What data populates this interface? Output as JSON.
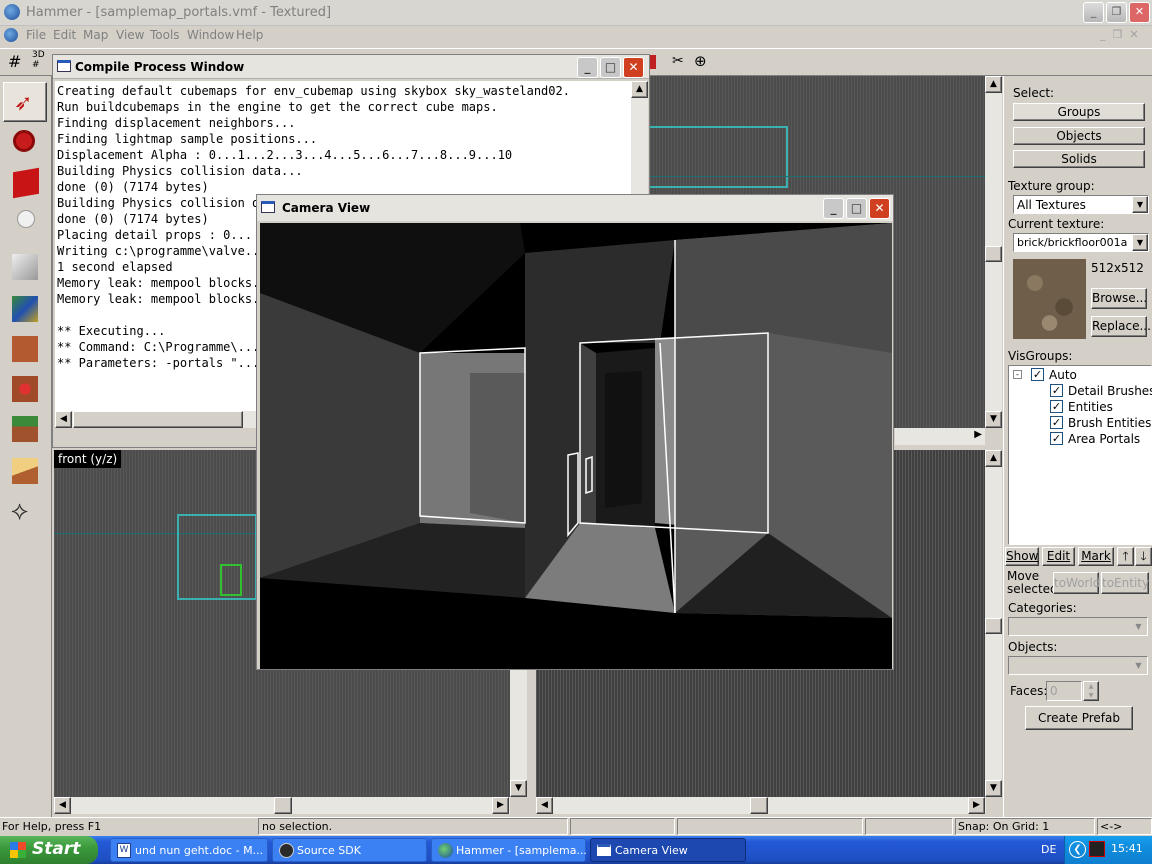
{
  "app": {
    "title": "Hammer - [samplemap_portals.vmf - Textured]"
  },
  "menu": [
    "File",
    "Edit",
    "Map",
    "View",
    "Tools",
    "Window",
    "Help"
  ],
  "compile": {
    "title": "Compile Process Window",
    "lines": [
      "Creating default cubemaps for env_cubemap using skybox sky_wasteland02.",
      "Run buildcubemaps in the engine to get the correct cube maps.",
      "Finding displacement neighbors...",
      "Finding lightmap sample positions...",
      "Displacement Alpha : 0...1...2...3...4...5...6...7...8...9...10",
      "Building Physics collision data...",
      "done (0) (7174 bytes)",
      "Building Physics collision data...",
      "done (0) (7174 bytes)",
      "Placing detail props : 0...",
      "Writing c:\\programme\\valve...",
      "1 second elapsed",
      "Memory leak: mempool blocks...",
      "Memory leak: mempool blocks...",
      "",
      "** Executing...",
      "** Command: C:\\Programme\\...",
      "** Parameters: -portals \"..."
    ]
  },
  "camera": {
    "title": "Camera View"
  },
  "viewport": {
    "front_label": "front (y/z)"
  },
  "panel": {
    "select_label": "Select:",
    "groups": "Groups",
    "objects": "Objects",
    "solids": "Solids",
    "texture_group_label": "Texture group:",
    "texture_group_value": "All Textures",
    "current_texture_label": "Current texture:",
    "current_texture_value": "brick/brickfloor001a",
    "texture_size": "512x512",
    "browse": "Browse...",
    "replace": "Replace...",
    "visgroups_label": "VisGroups:",
    "visgroups": [
      "Auto",
      "Detail Brushes",
      "Entities",
      "Brush Entities",
      "Area Portals"
    ],
    "show": "Show",
    "edit": "Edit",
    "mark": "Mark",
    "move_selected": "Move selected:",
    "to_world": "toWorld",
    "to_entity": "toEntity",
    "categories_label": "Categories:",
    "objects_label": "Objects:",
    "faces_label": "Faces:",
    "faces_value": "0",
    "create_prefab": "Create Prefab"
  },
  "status": {
    "help": "For Help, press F1",
    "selection": "no selection.",
    "snap": "Snap: On Grid: 1",
    "arrows": "<->"
  },
  "taskbar": {
    "start": "Start",
    "items": [
      "und nun geht.doc - M...",
      "Source SDK",
      "Hammer - [samplema...",
      "Camera View"
    ],
    "lang": "DE",
    "clock": "15:41"
  },
  "colors": {
    "title_active": "#0a246a",
    "xp_blue": "#2459d6",
    "start_green": "#3c9a3c"
  }
}
